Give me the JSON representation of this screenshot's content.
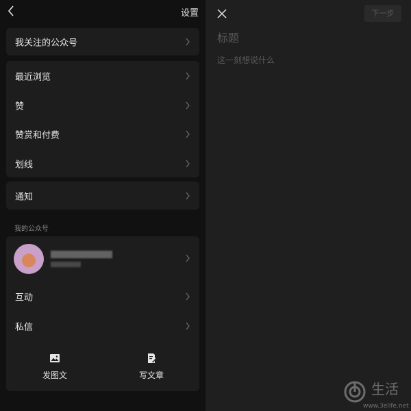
{
  "header": {
    "settings_label": "设置"
  },
  "menu": {
    "following": "我关注的公众号",
    "recent": "最近浏览",
    "like": "赞",
    "reward": "赞赏和付费",
    "underline": "划线",
    "notify": "通知"
  },
  "my_account": {
    "section_title": "我的公众号",
    "interact": "互动",
    "message": "私信",
    "post_image_text": "发图文",
    "write_article": "写文章"
  },
  "editor": {
    "next_label": "下一步",
    "title_placeholder": "标题",
    "body_placeholder": "这一刻想说什么"
  },
  "watermark": {
    "main": "生活",
    "url": "www.3elife.net"
  },
  "icons": {
    "back": "chevron-left-icon",
    "chevron": "chevron-right-icon",
    "close": "close-icon",
    "image": "image-icon",
    "edit": "document-edit-icon"
  },
  "colors": {
    "panel": "#1d1d1d",
    "bg": "#111111",
    "editor_bg": "#1f1f1f"
  }
}
